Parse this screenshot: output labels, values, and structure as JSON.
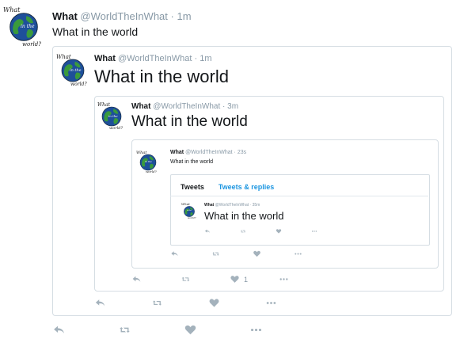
{
  "tweets": [
    {
      "name": "What",
      "handle": "@WorldTheInWhat",
      "sep": "·",
      "time": "1m",
      "text": "What in the world",
      "avatar_caption_top": "What",
      "avatar_caption_mid": "in the",
      "avatar_caption_bottom": "world?"
    },
    {
      "name": "What",
      "handle": "@WorldTheInWhat",
      "sep": "·",
      "time": "1m",
      "text": "What in the world",
      "avatar_caption_top": "What",
      "avatar_caption_mid": "in the",
      "avatar_caption_bottom": "world?"
    },
    {
      "name": "What",
      "handle": "@WorldTheInWhat",
      "sep": "·",
      "time": "3m",
      "text": "What in the world",
      "avatar_caption_top": "What",
      "avatar_caption_mid": "in the",
      "avatar_caption_bottom": "world?"
    },
    {
      "name": "What",
      "handle": "@WorldTheInWhat",
      "sep": "·",
      "time": "23s",
      "text": "What in the world",
      "avatar_caption_top": "What",
      "avatar_caption_mid": "in the",
      "avatar_caption_bottom": "world?"
    },
    {
      "name": "What",
      "handle": "@WorldTheInWhat",
      "sep": "·",
      "time": "35m",
      "text": "What in the world",
      "avatar_caption_top": "What",
      "avatar_caption_mid": "in the",
      "avatar_caption_bottom": "world?"
    }
  ],
  "profile_tabs": {
    "tweets": "Tweets",
    "replies": "Tweets & replies"
  },
  "like_count": "1",
  "icons": {
    "reply": "reply-icon",
    "retweet": "retweet-icon",
    "like": "heart-icon",
    "more": "more-icon"
  },
  "colors": {
    "link": "#1b95e0",
    "muted": "#8899a6",
    "border": "#d5dde3",
    "globe": "#2e7d32"
  }
}
